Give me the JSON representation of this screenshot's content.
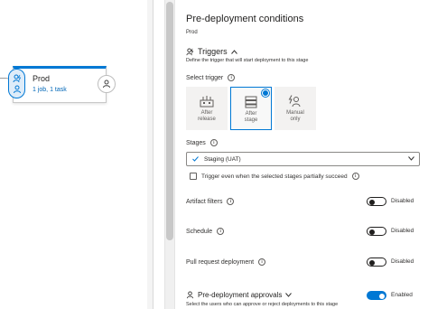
{
  "canvas": {
    "stage": {
      "name": "Prod",
      "summary": "1 job, 1 task"
    }
  },
  "panel": {
    "title": "Pre-deployment conditions",
    "subtitle": "Prod",
    "triggers": {
      "heading": "Triggers",
      "description": "Define the trigger that will start deployment to this stage",
      "select_label": "Select trigger",
      "options": [
        {
          "label": "After release",
          "icon": "release-icon",
          "selected": false
        },
        {
          "label": "After stage",
          "icon": "stage-icon",
          "selected": true
        },
        {
          "label": "Manual only",
          "icon": "manual-icon",
          "selected": false
        }
      ]
    },
    "stages": {
      "label": "Stages",
      "selected": "Staging (UAT)"
    },
    "partial_success": {
      "label": "Trigger even when the selected stages partially succeed",
      "checked": false
    },
    "artifact_filters": {
      "label": "Artifact filters",
      "state": "Disabled",
      "on": false
    },
    "schedule": {
      "label": "Schedule",
      "state": "Disabled",
      "on": false
    },
    "pull_request": {
      "label": "Pull request deployment",
      "state": "Disabled",
      "on": false
    },
    "approvals": {
      "heading": "Pre-deployment approvals",
      "state": "Enabled",
      "on": true,
      "description": "Select the users who can approve or reject deployments to this stage"
    }
  },
  "colors": {
    "accent": "#0078d4",
    "link": "#0067b8"
  }
}
